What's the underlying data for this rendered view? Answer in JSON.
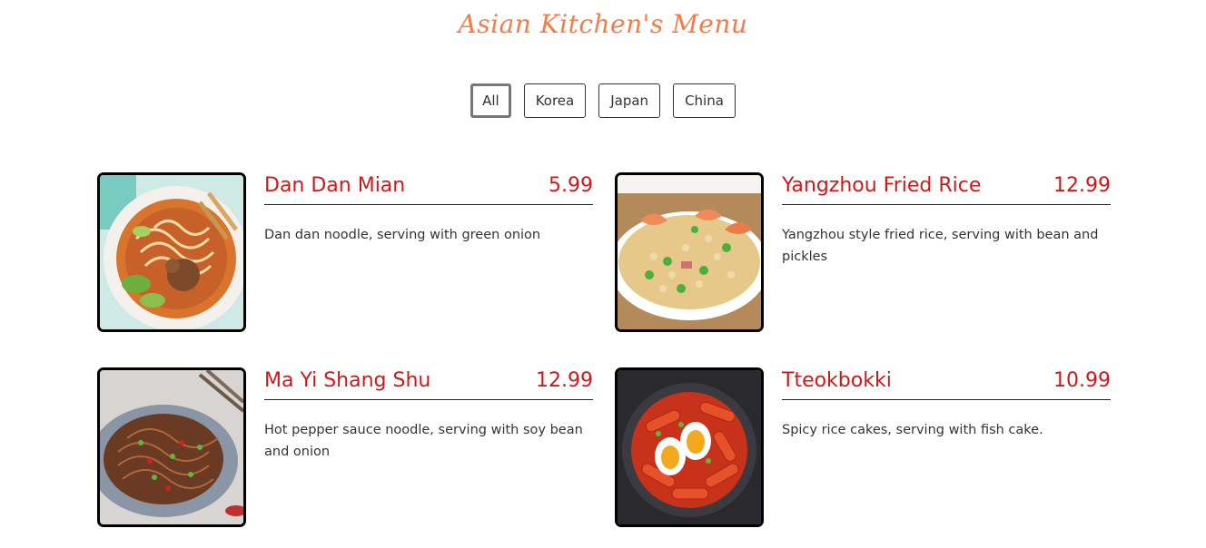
{
  "title": "Asian Kitchen's Menu",
  "filters": [
    "All",
    "Korea",
    "Japan",
    "China"
  ],
  "active_filter": "All",
  "colors": {
    "title": "#f47c48",
    "accent": "#cc1a1a"
  },
  "items": [
    {
      "name": "Dan Dan Mian",
      "price": "5.99",
      "description": "Dan dan noodle, serving with green onion",
      "image_icon": "noodle-bowl-icon"
    },
    {
      "name": "Yangzhou Fried Rice",
      "price": "12.99",
      "description": "Yangzhou style fried rice, serving with bean and pickles",
      "image_icon": "fried-rice-icon"
    },
    {
      "name": "Ma Yi Shang Shu",
      "price": "12.99",
      "description": "Hot pepper sauce noodle, serving with soy bean and onion",
      "image_icon": "glass-noodle-icon"
    },
    {
      "name": "Tteokbokki",
      "price": "10.99",
      "description": "Spicy rice cakes, serving with fish cake.",
      "image_icon": "rice-cake-icon"
    }
  ]
}
